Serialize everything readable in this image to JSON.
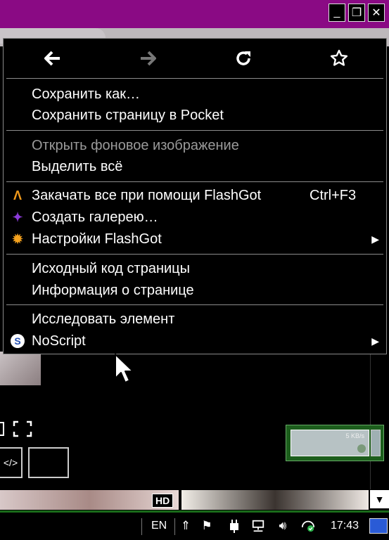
{
  "window": {
    "buttons": [
      {
        "name": "minimize",
        "glyph": "_"
      },
      {
        "name": "restore",
        "glyph": "❐"
      },
      {
        "name": "close",
        "glyph": "✕"
      }
    ]
  },
  "context_menu": {
    "nav": {
      "back_glyph": "🡐",
      "forward_glyph": "🡒",
      "reload_glyph": "↻",
      "bookmark_glyph": "☆"
    },
    "groups": [
      [
        {
          "label": "Сохранить как…"
        },
        {
          "label": "Сохранить страницу в Pocket"
        }
      ],
      [
        {
          "label": "Открыть фоновое изображение",
          "disabled": true
        },
        {
          "label": "Выделить всё"
        }
      ],
      [
        {
          "label": "Закачать все при помощи FlashGot",
          "shortcut": "Ctrl+F3",
          "icon": "flashgot-icon"
        },
        {
          "label": "Создать галерею…",
          "icon": "gallery-icon"
        },
        {
          "label": "Настройки FlashGot",
          "icon": "flashgot-settings-icon",
          "submenu": true
        }
      ],
      [
        {
          "label": "Исходный код страницы"
        },
        {
          "label": "Информация о странице"
        }
      ],
      [
        {
          "label": "Исследовать элемент"
        },
        {
          "label": "NoScript",
          "icon": "noscript-icon",
          "submenu": true
        }
      ]
    ]
  },
  "page": {
    "embed_label": "</>",
    "hd_badge": "HD",
    "network_widget": {
      "rate": "5 KB/s"
    }
  },
  "taskbar": {
    "language": "EN",
    "clock": "17:43"
  },
  "colors": {
    "titlebar": "#8a0a84",
    "taskbar_border": "#1a6b1a",
    "menu_bg": "#000000"
  }
}
